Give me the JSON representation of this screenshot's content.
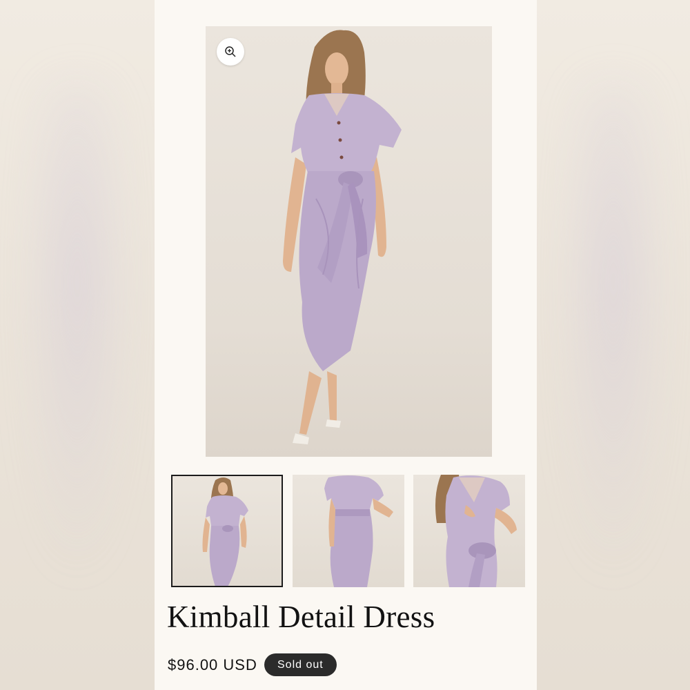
{
  "product": {
    "title": "Kimball Detail Dress",
    "price": "$96.00 USD",
    "status_badge": "Sold out"
  },
  "gallery": {
    "zoom_icon": "zoom-in-icon",
    "thumbnails": [
      "front-view",
      "back-view",
      "detail-view"
    ],
    "selected_index": 0
  },
  "colors": {
    "dress": "#c2b2cf",
    "badge": "#2b2b2b",
    "panel": "#fbf8f3"
  }
}
